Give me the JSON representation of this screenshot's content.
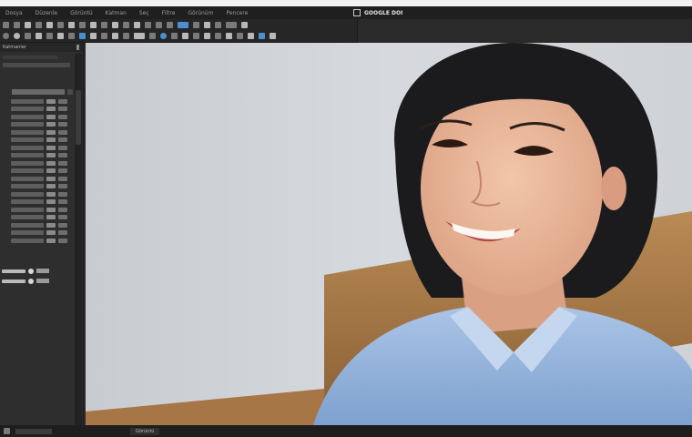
{
  "menubar": {
    "items": [
      "Dosya",
      "Düzenle",
      "Görüntü",
      "Katman",
      "Seç",
      "Filtre",
      "Görünüm",
      "Pencere"
    ]
  },
  "app": {
    "title": "GOOGLE DOI"
  },
  "panel": {
    "title": "Katmanlar"
  },
  "canvas": {
    "alt": "Smiling young person in a blue shirt"
  },
  "status": {
    "tab_label": "Görüntü"
  },
  "colors": {
    "accent": "#4a8fd0",
    "panel": "#2e2e2e",
    "chrome": "#1f1f1f"
  }
}
